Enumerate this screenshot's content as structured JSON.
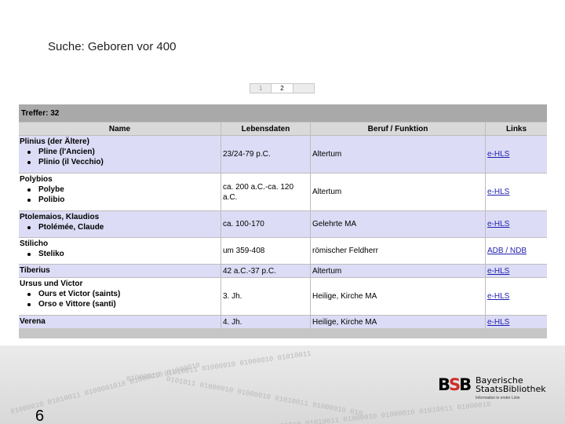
{
  "slide": {
    "title": "Suche: Geboren vor 400",
    "page_number": "6"
  },
  "pager": {
    "pages": [
      "1",
      "2"
    ],
    "current": "2"
  },
  "results": {
    "hits": "Treffer: 32",
    "columns": [
      "Name",
      "Lebensdaten",
      "Beruf / Funktion",
      "Links"
    ],
    "rows": [
      {
        "name": "Plinius (der Ältere)",
        "variants": [
          "Pline (l'Ancien)",
          "Plinio (il Vecchio)"
        ],
        "dates": "23/24-79 p.C.",
        "role": "Altertum",
        "link": "e-HLS"
      },
      {
        "name": "Polybios",
        "variants": [
          "Polybe",
          "Polibio"
        ],
        "dates": "ca. 200 a.C.-ca. 120 a.C.",
        "role": "Altertum",
        "link": "e-HLS"
      },
      {
        "name": "Ptolemaios, Klaudios",
        "variants": [
          "Ptolémée, Claude"
        ],
        "dates": "ca. 100-170",
        "role": "Gelehrte MA",
        "link": "e-HLS"
      },
      {
        "name": "Stilicho",
        "variants": [
          "Steliko"
        ],
        "dates": "um 359-408",
        "role": "römischer Feldherr",
        "link": "ADB / NDB"
      },
      {
        "name": "Tiberius",
        "variants": [],
        "dates": "42 a.C.-37 p.C.",
        "role": "Altertum",
        "link": "e-HLS"
      },
      {
        "name": "Ursus und Victor",
        "variants": [
          "Ours et Victor (saints)",
          "Orso e Vittore (santi)"
        ],
        "dates": "3. Jh.",
        "role": "Heilige, Kirche MA",
        "link": "e-HLS"
      },
      {
        "name": "Verena",
        "variants": [],
        "dates": "4. Jh.",
        "role": "Heilige, Kirche MA",
        "link": "e-HLS"
      }
    ]
  },
  "footer": {
    "binary_lines": [
      "01000010 01010011 01000010 01000010 01010011",
      "01000010 01010011 0100001010 01000010 01000010",
      "0101011 01000010 01000010 01010011 01000010 010",
      "01000010 01010011 01000010 01000010 01010011 01000010"
    ],
    "logo": {
      "mark_b1": "B",
      "mark_s": "S",
      "mark_b2": "B",
      "line1": "Bayerische",
      "line2": "StaatsBibliothek",
      "tagline": "Information in erster Linie"
    }
  }
}
